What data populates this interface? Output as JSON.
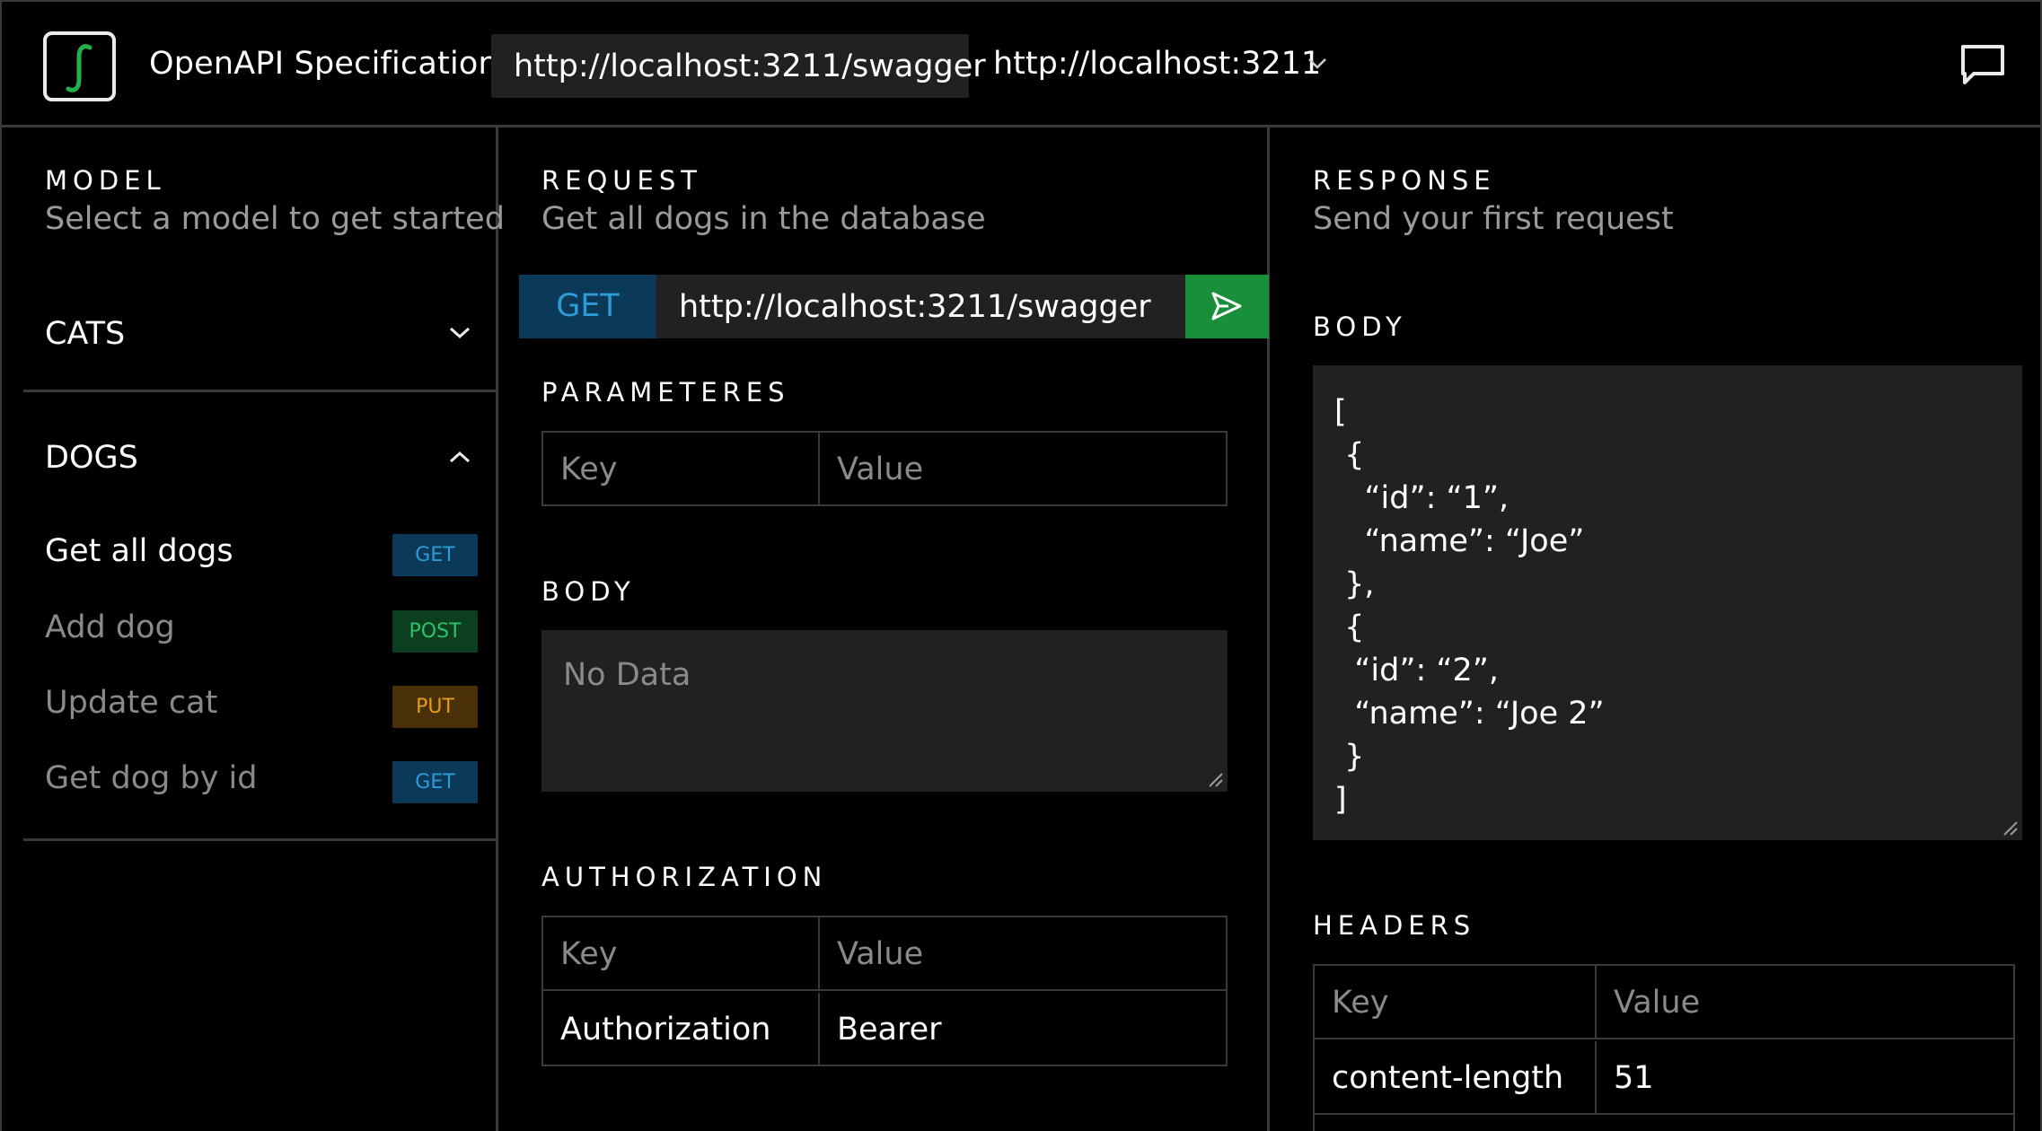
{
  "header": {
    "app_title": "OpenAPI Specification",
    "spec_url": "http://localhost:3211/swagger",
    "server_url": "http://localhost:3211"
  },
  "colors": {
    "background": "#000000",
    "panel": "#212121",
    "border": "#3a3a3a",
    "get": "#2e9ad6",
    "post": "#2fc26a",
    "put": "#e69a22",
    "send_button": "#1a8f3a"
  },
  "icons": {
    "logo": "integral-logo-icon",
    "server_dropdown": "chevron-down-icon",
    "feedback": "chat-bubble-icon",
    "send": "send-icon"
  },
  "model": {
    "label": "MODEL",
    "subtitle": "Select a model to get started",
    "groups": [
      {
        "title": "CATS",
        "expanded": false
      },
      {
        "title": "DOGS",
        "expanded": true,
        "endpoints": [
          {
            "label": "Get all dogs",
            "method": "GET",
            "active": true
          },
          {
            "label": "Add dog",
            "method": "POST",
            "active": false
          },
          {
            "label": "Update cat",
            "method": "PUT",
            "active": false
          },
          {
            "label": "Get dog by id",
            "method": "GET",
            "active": false
          }
        ]
      }
    ]
  },
  "request": {
    "label": "REQUEST",
    "subtitle": "Get all dogs in the database",
    "method": "GET",
    "url": "http://localhost:3211/swagger",
    "parameters": {
      "label": "PARAMETERES",
      "key_placeholder": "Key",
      "value_placeholder": "Value"
    },
    "body": {
      "label": "BODY",
      "placeholder": "No Data"
    },
    "authorization": {
      "label": "AUTHORIZATION",
      "key_placeholder": "Key",
      "value_placeholder": "Value",
      "rows": [
        {
          "key": "Authorization",
          "value": "Bearer"
        }
      ]
    }
  },
  "response": {
    "label": "RESPONSE",
    "subtitle": "Send your first request",
    "body": {
      "label": "BODY",
      "lines": [
        "[",
        " {",
        "   “id”: “1”,",
        "   “name”: “Joe”",
        " },",
        " {",
        "  “id”: “2”,",
        "  “name”: “Joe 2”",
        " }",
        "]"
      ]
    },
    "headers": {
      "label": "HEADERS",
      "key_placeholder": "Key",
      "value_placeholder": "Value",
      "rows": [
        {
          "key": "content-length",
          "value": "51"
        }
      ]
    }
  }
}
